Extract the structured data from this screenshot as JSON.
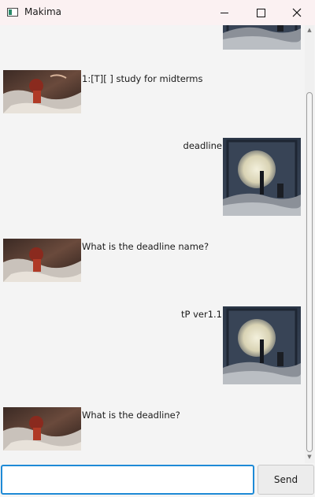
{
  "window": {
    "title": "Makima"
  },
  "messages": [
    {
      "from": "user",
      "text": ""
    },
    {
      "from": "bot",
      "text": "1:[T][ ] study for midterms"
    },
    {
      "from": "user",
      "text": "deadline"
    },
    {
      "from": "bot",
      "text": "What is the deadline name?"
    },
    {
      "from": "user",
      "text": "tP ver1.1"
    },
    {
      "from": "bot",
      "text": "What is the deadline?"
    }
  ],
  "input": {
    "value": "",
    "placeholder": ""
  },
  "send_button": {
    "label": "Send"
  },
  "icons": {
    "app": "app-window-icon",
    "minimize": "minimize-icon",
    "maximize": "maximize-icon",
    "close": "close-icon"
  }
}
